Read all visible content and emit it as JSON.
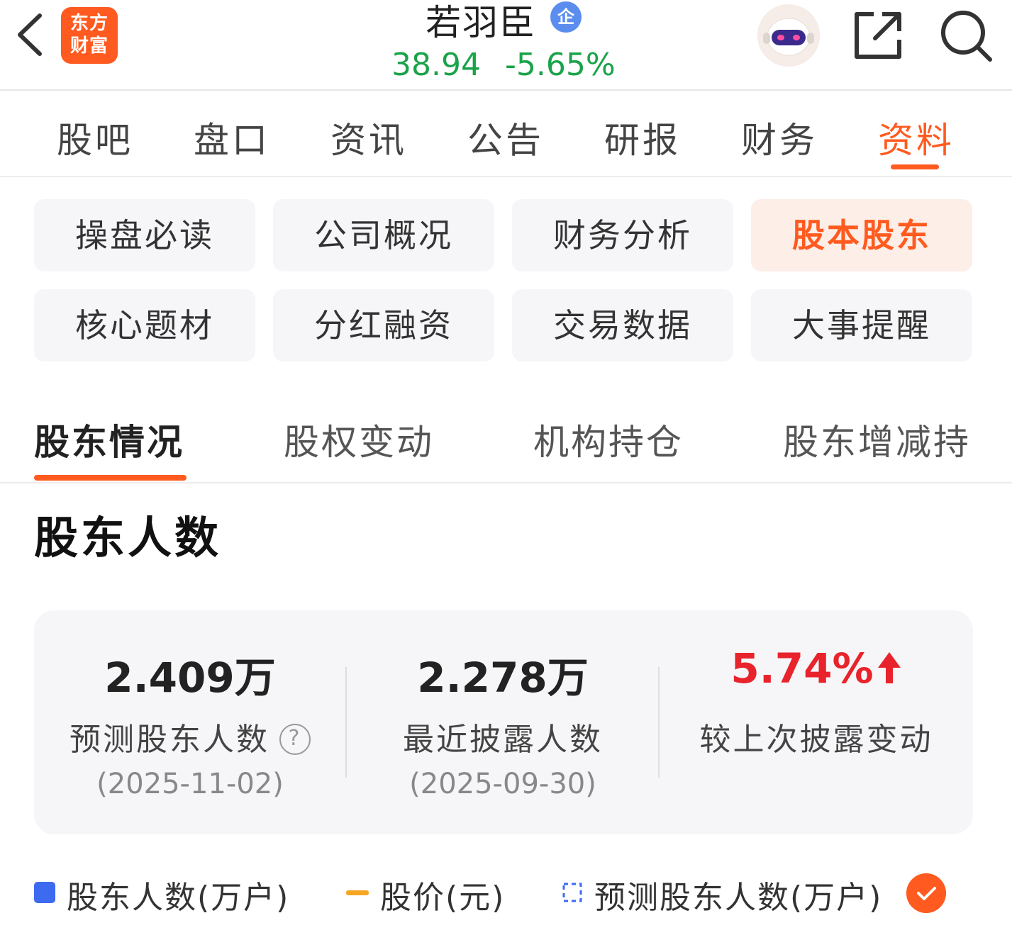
{
  "header": {
    "logo_line1": "东方",
    "logo_line2": "财富",
    "stock_name": "若羽臣",
    "badge": "企",
    "price": "38.94",
    "change": "-5.65%"
  },
  "main_tabs": [
    "股吧",
    "盘口",
    "资讯",
    "公告",
    "研报",
    "财务",
    "资料"
  ],
  "grid_buttons": [
    "操盘必读",
    "公司概况",
    "财务分析",
    "股本股东",
    "核心题材",
    "分红融资",
    "交易数据",
    "大事提醒"
  ],
  "sub_tabs": [
    "股东情况",
    "股权变动",
    "机构持仓",
    "股东增减持"
  ],
  "section_title": "股东人数",
  "stats": {
    "predicted": {
      "value": "2.409万",
      "label": "预测股东人数",
      "date": "(2025-11-02)"
    },
    "latest": {
      "value": "2.278万",
      "label": "最近披露人数",
      "date": "(2025-09-30)"
    },
    "change": {
      "value": "5.74%",
      "label": "较上次披露变动"
    }
  },
  "legend": {
    "holders": "股东人数(万户)",
    "price": "股价(元)",
    "predicted": "预测股东人数(万户)"
  },
  "colors": {
    "accent": "#ff5a1f",
    "down_green": "#1aa34a",
    "up_red": "#e8232b",
    "series_blue": "#3d6bf0",
    "series_orange": "#f5a623"
  },
  "icons": {
    "back": "chevron-left-icon",
    "share": "share-icon",
    "search": "search-icon",
    "help": "question-circle-icon",
    "up": "arrow-up-icon",
    "check": "check-icon"
  }
}
